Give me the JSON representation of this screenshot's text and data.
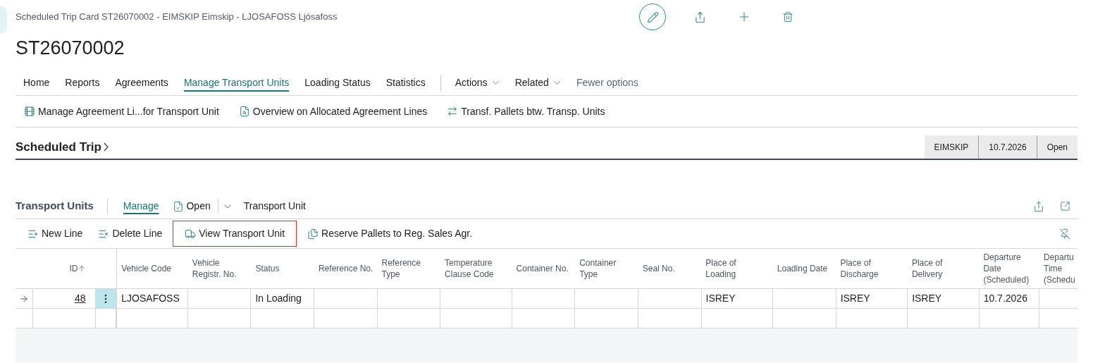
{
  "window": {
    "title": "Scheduled Trip Card ST26070002 - EIMSKIP Eimskip - LJOSAFOSS Ljósafoss",
    "heading": "ST26070002"
  },
  "tabs": [
    {
      "label": "Home",
      "selected": false
    },
    {
      "label": "Reports",
      "selected": false
    },
    {
      "label": "Agreements",
      "selected": false
    },
    {
      "label": "Manage Transport Units",
      "selected": true
    },
    {
      "label": "Loading Status",
      "selected": false
    },
    {
      "label": "Statistics",
      "selected": false
    }
  ],
  "menus": [
    {
      "label": "Actions",
      "kind": "dropdown"
    },
    {
      "label": "Related",
      "kind": "dropdown"
    },
    {
      "label": "Fewer options",
      "kind": "link"
    }
  ],
  "actions": [
    {
      "label": "Manage Agreement Li...for Transport Unit"
    },
    {
      "label": "Overview on Allocated Agreement Lines"
    },
    {
      "label": "Transf. Pallets btw. Transp. Units"
    }
  ],
  "section": {
    "title": "Scheduled Trip",
    "badges": [
      "EIMSKIP",
      "10.7.2026",
      "Open"
    ]
  },
  "part": {
    "title": "Transport Units",
    "tabs": [
      {
        "label": "Manage",
        "selected": true
      }
    ],
    "open_button": "Open",
    "menu": "Transport Unit",
    "actions": [
      {
        "label": "New Line",
        "highlighted": false
      },
      {
        "label": "Delete Line",
        "highlighted": false
      },
      {
        "label": "View Transport Unit",
        "highlighted": true
      },
      {
        "label": "Reserve Pallets to Reg. Sales Agr.",
        "highlighted": false
      }
    ]
  },
  "table": {
    "columns": [
      {
        "label": "ID",
        "sorted": true
      },
      {
        "label": "Vehicle Code",
        "sorted": false
      },
      {
        "label": "Vehicle Registr. No.",
        "sorted": false
      },
      {
        "label": "Status",
        "sorted": false
      },
      {
        "label": "Reference No.",
        "sorted": false
      },
      {
        "label": "Reference Type",
        "sorted": false
      },
      {
        "label": "Temperature Clause Code",
        "sorted": false
      },
      {
        "label": "Container No.",
        "sorted": false
      },
      {
        "label": "Container Type",
        "sorted": false
      },
      {
        "label": "Seal No.",
        "sorted": false
      },
      {
        "label": "Place of Loading",
        "sorted": false
      },
      {
        "label": "Loading Date",
        "sorted": false
      },
      {
        "label": "Place of Discharge",
        "sorted": false
      },
      {
        "label": "Place of Delivery",
        "sorted": false
      },
      {
        "label": "Departure Date (Scheduled)",
        "sorted": false
      },
      {
        "label": "Departu Time (Schedu",
        "sorted": false
      }
    ],
    "rows": [
      {
        "current": true,
        "cells": [
          "48",
          "LJOSAFOSS",
          null,
          "In Loading",
          null,
          null,
          null,
          null,
          null,
          null,
          "ISREY",
          null,
          "ISREY",
          "ISREY",
          "10.7.2026",
          null
        ]
      },
      {
        "current": false,
        "cells": [
          null,
          null,
          null,
          null,
          null,
          null,
          null,
          null,
          null,
          null,
          null,
          null,
          null,
          null,
          null,
          null
        ]
      }
    ]
  }
}
